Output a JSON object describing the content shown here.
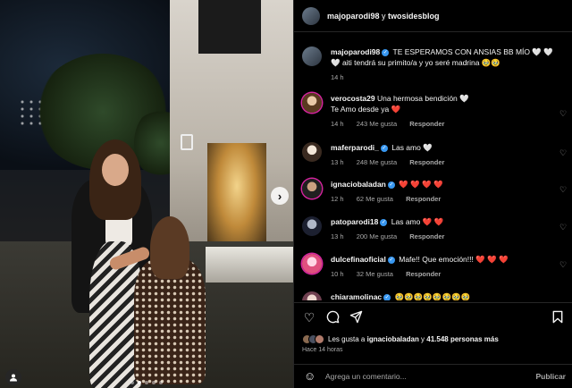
{
  "post": {
    "carousel": {
      "slides": 5,
      "active_index": 1
    }
  },
  "header": {
    "user1": "majoparodi98",
    "connector": " y ",
    "user2": "twosidesblog"
  },
  "caption": {
    "username": "majoparodi98",
    "text": "TE ESPERAMOS CON ANSIAS BB MÍO 🤍 🤍 🤍 aiti tendrá su primito/a y yo seré madrina 🥹🥹",
    "time": "14 h"
  },
  "comments": [
    {
      "username": "verocosta29",
      "text": "Una hermosa bendición 🤍",
      "text2": "Te Amo desde ya ❤️",
      "time": "14 h",
      "likes": "243 Me gusta",
      "reply": "Responder"
    },
    {
      "username": "maferparodi_",
      "verified": true,
      "text": "Las amo 🤍",
      "time": "13 h",
      "likes": "248 Me gusta",
      "reply": "Responder"
    },
    {
      "username": "ignaciobaladan",
      "verified": true,
      "text": "❤️ ❤️ ❤️ ❤️",
      "time": "12 h",
      "likes": "62 Me gusta",
      "reply": "Responder"
    },
    {
      "username": "patoparodi18",
      "verified": true,
      "text": "Las amo ❤️ ❤️",
      "time": "13 h",
      "likes": "200 Me gusta",
      "reply": "Responder"
    },
    {
      "username": "dulcefinaoficial",
      "verified": true,
      "text": "Mafe!! Que emoción!!! ❤️ ❤️ ❤️",
      "time": "10 h",
      "likes": "32 Me gusta",
      "reply": "Responder"
    },
    {
      "username": "chiaramolinac",
      "verified": true,
      "text": "🥹🥹🥹🥹🥹🥹🥹🥹"
    }
  ],
  "likes": {
    "prefix": "Les gusta a ",
    "user": "ignaciobaladan",
    "middle": " y ",
    "count": "41.548 personas más"
  },
  "time_ago": "Hace 14 horas",
  "comment_box": {
    "placeholder": "Agrega un comentario...",
    "publish": "Publicar"
  },
  "icons": {
    "heart": "heart-icon",
    "comment": "comment-icon",
    "share": "share-icon",
    "save": "bookmark-icon",
    "emoji": "emoji-icon",
    "next": "chevron-right-icon",
    "tag": "user-tag-icon",
    "verified": "verified-badge-icon"
  },
  "colors": {
    "background": "#000000",
    "text": "#f5f5f5",
    "muted": "#a8a8a8",
    "verified": "#3897f0",
    "divider": "#262626"
  }
}
